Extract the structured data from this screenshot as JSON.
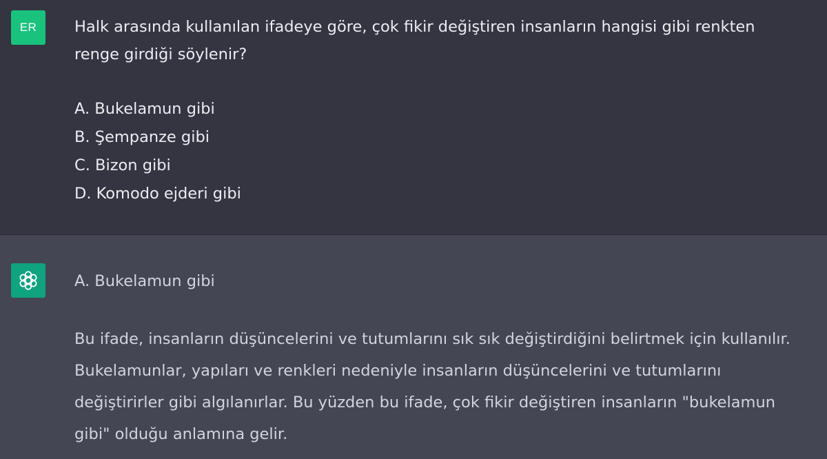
{
  "user_message": {
    "avatar_initials": "ER",
    "question_lines": [
      "Halk arasında kullanılan ifadeye göre, çok fikir değiştiren insanların hangisi gibi renkten",
      "renge girdiği söylenir?"
    ],
    "options": [
      "A. Bukelamun gibi",
      "B. Şempanze gibi",
      "C. Bizon gibi",
      "D. Komodo ejderi gibi"
    ]
  },
  "assistant_message": {
    "avatar_icon": "openai-logo-icon",
    "answer": "A. Bukelamun gibi",
    "explanation_lines": [
      "Bu ifade, insanların düşüncelerini ve tutumlarını sık sık değiştirdiğini belirtmek için kullanılır.",
      "Bukelamunlar, yapıları ve renkleri nedeniyle insanların düşüncelerini ve tutumlarını",
      "değiştirirler gibi algılanırlar. Bu yüzden bu ifade, çok fikir değiştiren insanların \"bukelamun",
      "gibi\" olduğu anlamına gelir."
    ]
  },
  "colors": {
    "user_bg": "#343541",
    "assistant_bg": "#444654",
    "user_avatar": "#19c37d",
    "assistant_avatar": "#10a37f"
  }
}
